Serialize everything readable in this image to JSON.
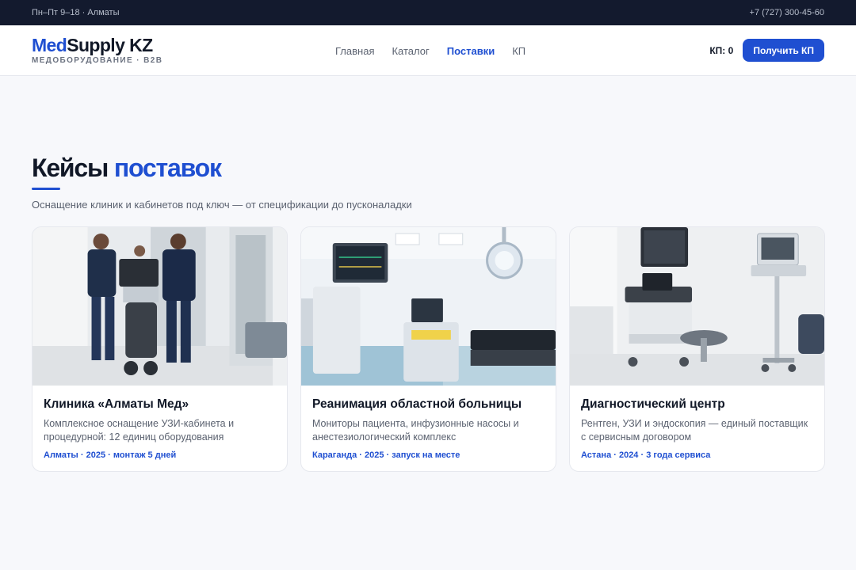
{
  "topbar": {
    "hours": "Пн–Пт 9–18 · Алматы",
    "phone": "+7 (727) 300-45-60"
  },
  "brand": {
    "name_accent": "Med",
    "name_rest": "Supply KZ",
    "tagline": "МЕДОБОРУДОВАНИЕ · B2B",
    "accent_color": "#1f4fd1"
  },
  "nav": {
    "items": [
      "Главная",
      "Каталог",
      "Поставки",
      "КП"
    ],
    "active": "Поставки"
  },
  "header": {
    "kp_counter": "КП: 0",
    "cta_label": "Получить КП"
  },
  "section": {
    "title_main": "Кейсы",
    "title_accent": "поставок",
    "subtitle": "Оснащение клиник и кабинетов под ключ — от спецификации до пусконаладки"
  },
  "cases": [
    {
      "title": "Клиника «Алматы Мед»",
      "description": "Комплексное оснащение УЗИ-кабинета и процедурной: 12 единиц оборудования",
      "meta": "Алматы · 2025 · монтаж 5 дней",
      "image": "photo-technicians-moving-ultrasound"
    },
    {
      "title": "Реанимация областной больницы",
      "description": "Мониторы пациента, инфузионные насосы и анестезиологический комплекс",
      "meta": "Караганда · 2025 · запуск на месте",
      "image": "photo-operating-room"
    },
    {
      "title": "Диагностический центр",
      "description": "Рентген, УЗИ и эндоскопия — единый поставщик с сервисным договором",
      "meta": "Астана · 2024 · 3 года сервиса",
      "image": "photo-diagnostic-room"
    }
  ]
}
